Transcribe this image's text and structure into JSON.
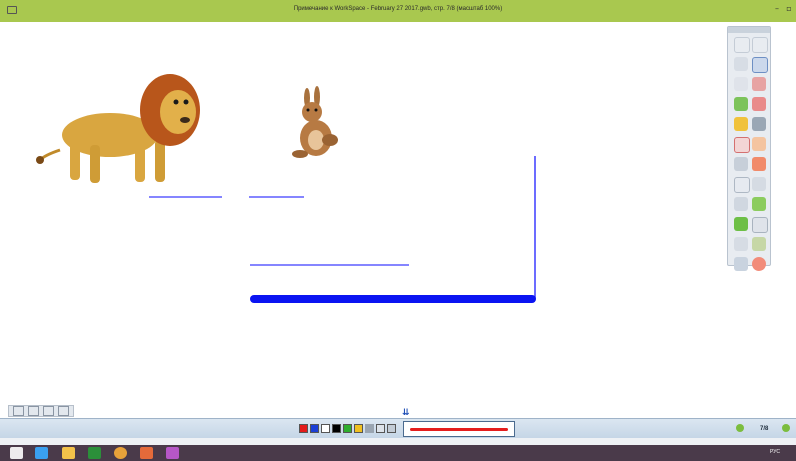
{
  "window": {
    "title": "Примечание к WorkSpace - February 27 2017.gwb, стр. 7/8 (масштаб 100%)",
    "minimize_label": "–",
    "restore_label": "▫"
  },
  "canvas": {
    "objects": [
      {
        "name": "lion-image"
      },
      {
        "name": "hare-image"
      }
    ],
    "line_color": "#3c3cff",
    "bold_line_color": "#0b14f2"
  },
  "bottom_bar": {
    "colors": [
      "#e31b1b",
      "#1b3fd6",
      "#ffffff",
      "#000000",
      "#2fae2f",
      "#f0c020"
    ],
    "pen_color": "#e41d1d",
    "page_indicator": "7/8"
  },
  "taskbar": {
    "tray_lang": "РУС"
  },
  "colors": {
    "title_bar": "#a9c84f",
    "toolbar_bg": "#e8ecf1",
    "taskbar_bg": "#4a3a4a"
  }
}
